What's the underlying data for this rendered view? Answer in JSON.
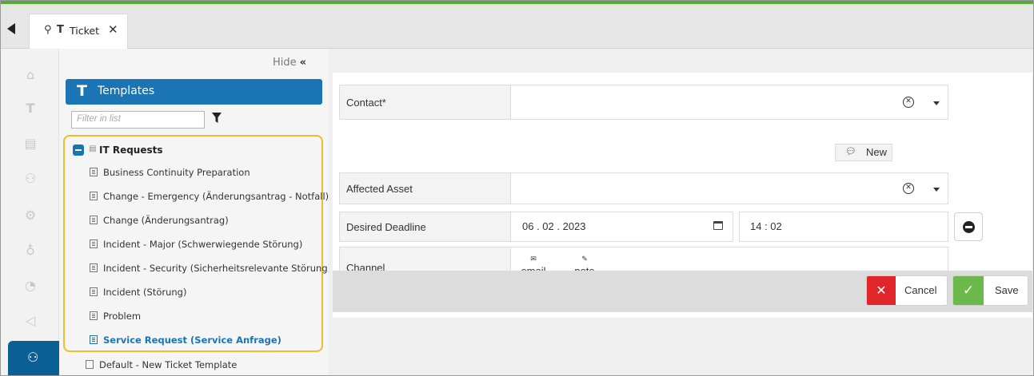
{
  "tab": {
    "pin_icon": "pin-icon",
    "type_icon": "T",
    "label": "Ticket",
    "close_icon": "✕"
  },
  "rail": {
    "icons": [
      "home-icon",
      "ticket-icon",
      "database-icon",
      "people-icon",
      "gear-icon",
      "lightbulb-icon",
      "pie-icon",
      "megaphone-icon",
      "admin-icon"
    ]
  },
  "panel": {
    "hide_label": "Hide",
    "hide_icon": "«",
    "templates_icon": "T",
    "templates_label": "Templates",
    "filter_placeholder": "Filter in list",
    "tree": {
      "root_label": "IT Requests",
      "items": [
        "Business Continuity Preparation",
        "Change - Emergency (Änderungsantrag - Notfall)",
        "Change (Änderungsantrag)",
        "Incident - Major (Schwerwiegende Störung)",
        "Incident - Security (Sicherheitsrelevante Störung)",
        "Incident (Störung)",
        "Problem",
        "Service Request (Service Anfrage)"
      ],
      "selected_index": 7
    },
    "default_item": "Default - New Ticket Template"
  },
  "form": {
    "contact_label": "Contact*",
    "contact_value": "",
    "new_button_label": "New",
    "affected_asset_label": "Affected Asset",
    "affected_asset_value": "",
    "desired_deadline_label": "Desired Deadline",
    "deadline_date": "06 . 02 . 2023",
    "deadline_time": "14 : 02",
    "channel_label": "Channel",
    "channel_options": [
      "email",
      "note"
    ]
  },
  "actions": {
    "cancel_label": "Cancel",
    "save_label": "Save"
  },
  "colors": {
    "accent": "#1b74b4",
    "cancel": "#e0262b",
    "save": "#6cb84a",
    "highlight_border": "#f0bd2e",
    "top_bar": "#5aa542"
  }
}
